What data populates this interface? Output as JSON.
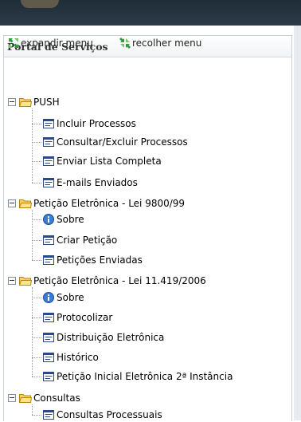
{
  "panel": {
    "title": "Portal de Serviços"
  },
  "toolbar": {
    "expand_label": "expandir menu",
    "collapse_label": "recolher menu"
  },
  "tree": {
    "push": {
      "label": "PUSH",
      "items": [
        "Incluir Processos",
        "Consultar/Excluir Processos",
        "Enviar Lista Completa",
        "E-mails Enviados"
      ]
    },
    "peticao1": {
      "label": "Petição Eletrônica - Lei 9800/99",
      "items": [
        "Sobre",
        "Criar Petição",
        "Petições Enviadas"
      ]
    },
    "peticao2": {
      "label": "Petição Eletrônica - Lei 11.419/2006",
      "items": [
        "Sobre",
        "Protocolizar",
        "Distribuição Eletrônica",
        "Histórico",
        "Petição Inicial Eletrônica 2ª Instância"
      ]
    },
    "consultas": {
      "label": "Consultas",
      "items": [
        "Consultas Processuais"
      ]
    }
  },
  "colors": {
    "topbar": "#2c3b47",
    "folder": "#f0c419",
    "info": "#3a7bd5"
  }
}
